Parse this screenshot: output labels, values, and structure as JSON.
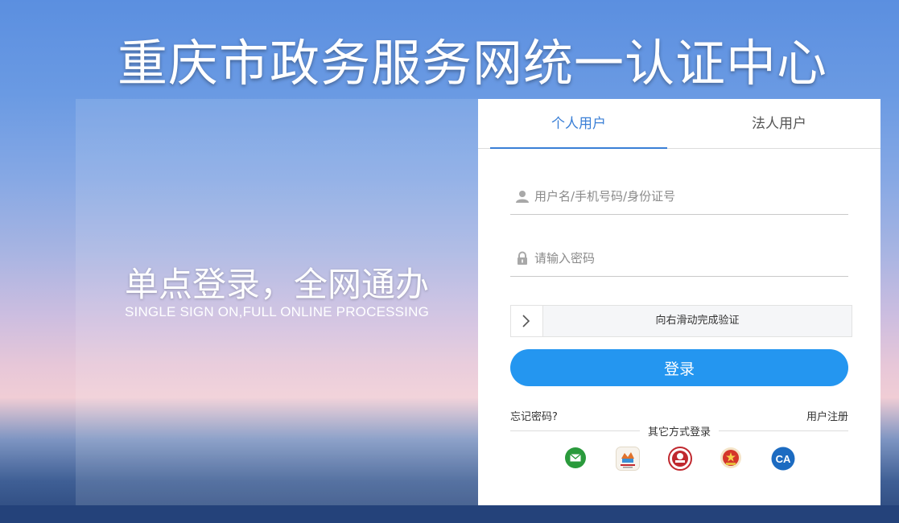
{
  "header": {
    "title": "重庆市政务服务网统一认证中心"
  },
  "hero": {
    "slogan": "单点登录，全网通办",
    "subtitle": "SINGLE SIGN ON,FULL ONLINE PROCESSING"
  },
  "tabs": [
    {
      "label": "个人用户",
      "active": true
    },
    {
      "label": "法人用户",
      "active": false
    }
  ],
  "form": {
    "username_placeholder": "用户名/手机号码/身份证号",
    "username_value": "",
    "password_placeholder": "请输入密码",
    "password_value": "",
    "slider_text": "向右滑动完成验证",
    "login_label": "登录",
    "forgot_label": "忘记密码?",
    "register_label": "用户注册",
    "other_login_title": "其它方式登录"
  },
  "alt_logins": [
    {
      "icon": "message-icon",
      "color": "#2a9a3c"
    },
    {
      "icon": "app-logo-icon",
      "color": "#e0722b"
    },
    {
      "icon": "seal-badge-icon",
      "color": "#c0282e"
    },
    {
      "icon": "national-emblem-icon",
      "color": "#d4352a"
    },
    {
      "icon": "ca-icon",
      "color": "#1c6bc1",
      "text": "CA"
    }
  ],
  "colors": {
    "accent": "#3a7fd6",
    "login_button": "#2496f0"
  }
}
